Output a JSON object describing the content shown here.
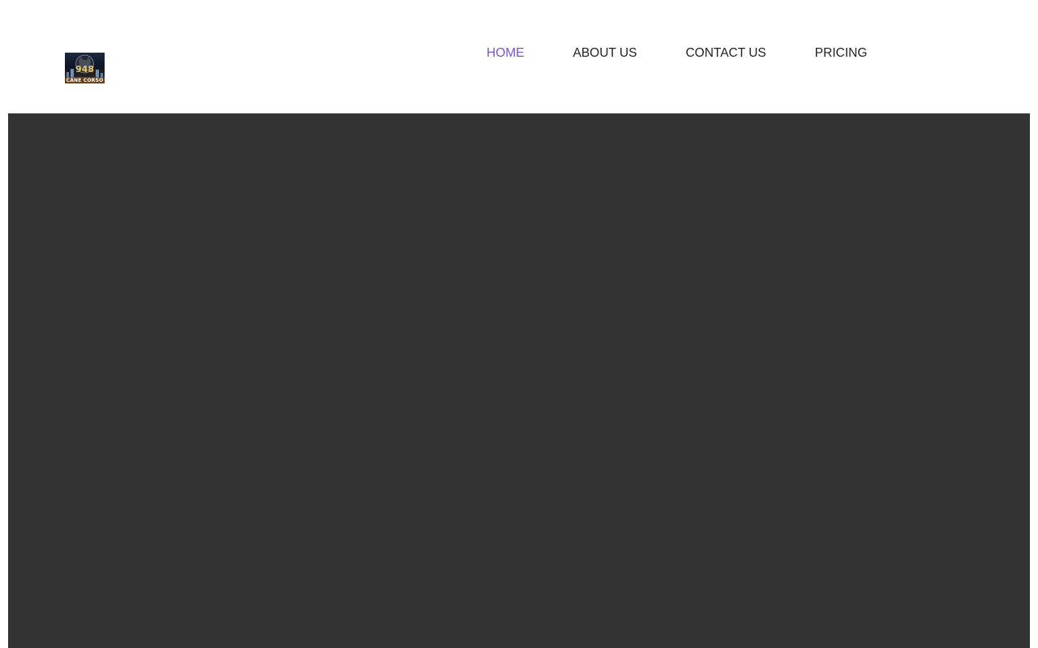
{
  "header": {
    "logo": {
      "number": "948",
      "caption": "CANE CORSO",
      "icon": "dog-logo-icon"
    },
    "nav": {
      "items": [
        {
          "label": "HOME",
          "active": true
        },
        {
          "label": "ABOUT US",
          "active": false
        },
        {
          "label": "CONTACT US",
          "active": false
        },
        {
          "label": "PRICING",
          "active": false
        }
      ]
    }
  },
  "colors": {
    "active_nav": "#7b55c9",
    "nav_text": "#222222",
    "hero_background": "#333333",
    "header_background": "#ffffff"
  }
}
